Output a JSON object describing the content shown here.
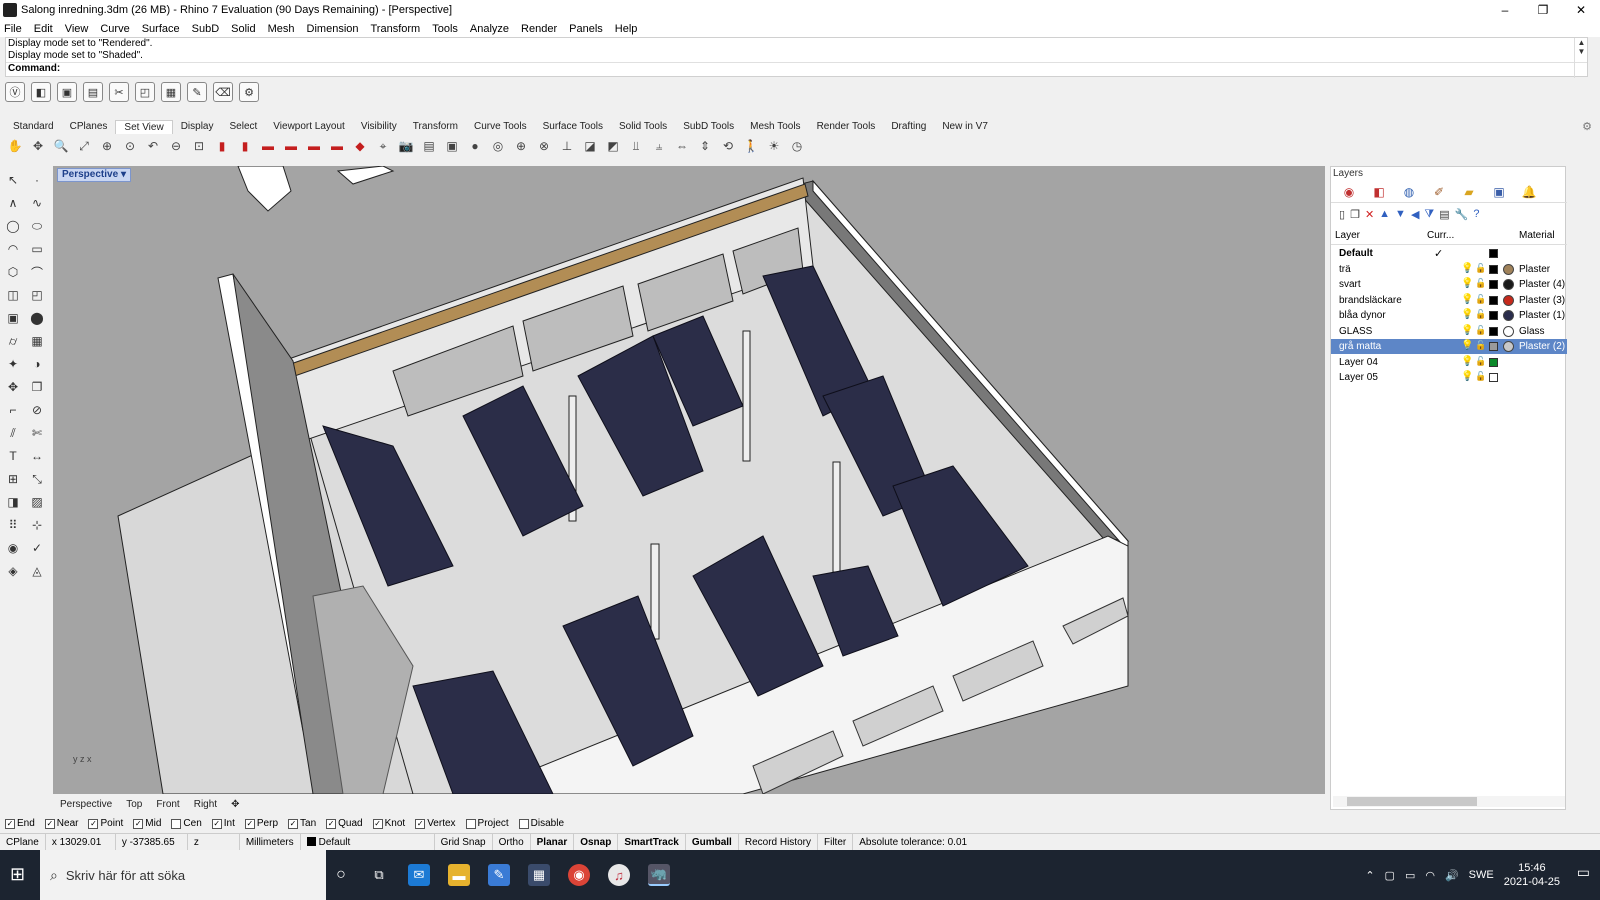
{
  "window": {
    "title": "Salong inredning.3dm (26 MB) - Rhino 7 Evaluation (90 Days Remaining) - [Perspective]",
    "controls": [
      "–",
      "❐",
      "✕"
    ]
  },
  "menu": [
    "File",
    "Edit",
    "View",
    "Curve",
    "Surface",
    "SubD",
    "Solid",
    "Mesh",
    "Dimension",
    "Transform",
    "Tools",
    "Analyze",
    "Render",
    "Panels",
    "Help"
  ],
  "command_history": [
    "Display mode set to \"Rendered\".",
    "Display mode set to \"Shaded\"."
  ],
  "command_prompt": "Command:",
  "toolbar_tabs": [
    "Standard",
    "CPlanes",
    "Set View",
    "Display",
    "Select",
    "Viewport Layout",
    "Visibility",
    "Transform",
    "Curve Tools",
    "Surface Tools",
    "Solid Tools",
    "SubD Tools",
    "Mesh Tools",
    "Render Tools",
    "Drafting",
    "New in V7"
  ],
  "active_toolbar_tab": "Set View",
  "viewport": {
    "label": "Perspective",
    "axis_label": "y z x"
  },
  "viewport_tabs": [
    "Perspective",
    "Top",
    "Front",
    "Right",
    "✥"
  ],
  "layers": {
    "title": "Layers",
    "columns": {
      "layer": "Layer",
      "current": "Curr...",
      "material": "Material"
    },
    "rows": [
      {
        "name": "Default",
        "current": true,
        "color": "#000000",
        "material": "",
        "mat_color": "",
        "bold": true,
        "selected": false
      },
      {
        "name": "trä",
        "current": false,
        "color": "#000000",
        "material": "Plaster",
        "mat_color": "#a0825a",
        "bold": false,
        "selected": false
      },
      {
        "name": "svart",
        "current": false,
        "color": "#000000",
        "material": "Plaster (4)",
        "mat_color": "#1a1a1a",
        "bold": false,
        "selected": false
      },
      {
        "name": "brandsläckare",
        "current": false,
        "color": "#000000",
        "material": "Plaster (3)",
        "mat_color": "#c62a1c",
        "bold": false,
        "selected": false
      },
      {
        "name": "blåa dynor",
        "current": false,
        "color": "#000000",
        "material": "Plaster (1)",
        "mat_color": "#2a2d4c",
        "bold": false,
        "selected": false
      },
      {
        "name": "GLASS",
        "current": false,
        "color": "#000000",
        "material": "Glass",
        "mat_color": "#ffffff",
        "bold": false,
        "selected": false
      },
      {
        "name": "grå matta",
        "current": false,
        "color": "#9a9a9a",
        "material": "Plaster (2)",
        "mat_color": "#c8c8c8",
        "bold": false,
        "selected": true
      },
      {
        "name": "Layer 04",
        "current": false,
        "color": "#0c8a2a",
        "material": "",
        "mat_color": "",
        "bold": false,
        "selected": false
      },
      {
        "name": "Layer 05",
        "current": false,
        "color": "#ffffff",
        "material": "",
        "mat_color": "",
        "bold": false,
        "selected": false
      }
    ]
  },
  "osnaps": [
    {
      "label": "End",
      "checked": true
    },
    {
      "label": "Near",
      "checked": true
    },
    {
      "label": "Point",
      "checked": true
    },
    {
      "label": "Mid",
      "checked": true
    },
    {
      "label": "Cen",
      "checked": false
    },
    {
      "label": "Int",
      "checked": true
    },
    {
      "label": "Perp",
      "checked": true
    },
    {
      "label": "Tan",
      "checked": true
    },
    {
      "label": "Quad",
      "checked": true
    },
    {
      "label": "Knot",
      "checked": true
    },
    {
      "label": "Vertex",
      "checked": true
    },
    {
      "label": "Project",
      "checked": false
    },
    {
      "label": "Disable",
      "checked": false
    }
  ],
  "status": {
    "cplane": "CPlane",
    "x": "x 13029.01",
    "y": "y -37385.65",
    "z": "z",
    "units": "Millimeters",
    "layer": "Default",
    "grid_snap": "Grid Snap",
    "ortho": "Ortho",
    "planar": "Planar",
    "osnap": "Osnap",
    "smarttrack": "SmartTrack",
    "gumball": "Gumball",
    "record_history": "Record History",
    "filter": "Filter",
    "tolerance": "Absolute tolerance: 0.01"
  },
  "taskbar": {
    "search_placeholder": "Skriv här för att söka",
    "language": "SWE",
    "time": "15:46",
    "date": "2021-04-25"
  },
  "colors": {
    "viewport_bg": "#a4a4a4",
    "seat": "#2b2d48",
    "wall": "#ffffff",
    "floor": "#d7d7d7",
    "selection": "#5d86c7"
  }
}
